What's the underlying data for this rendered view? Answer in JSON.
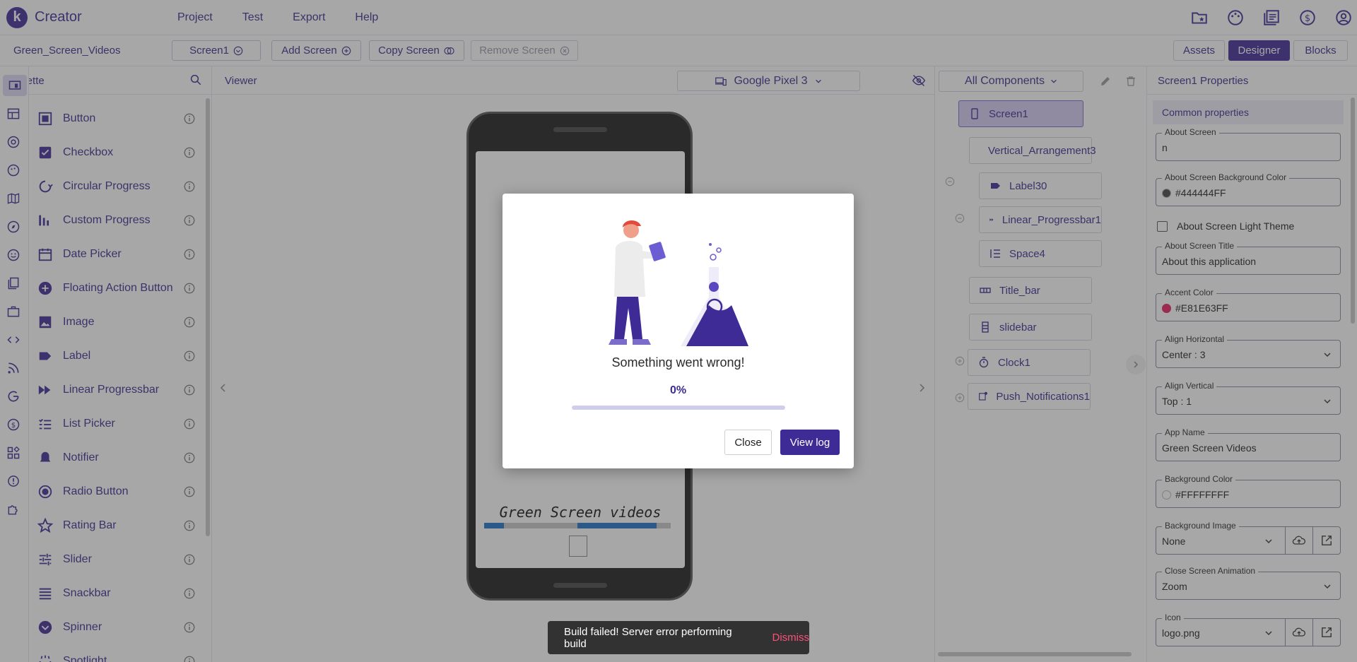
{
  "app": {
    "name": "Creator",
    "logo_letter": "k"
  },
  "menu": [
    "Project",
    "Test",
    "Export",
    "Help"
  ],
  "top_icons": [
    "folder-star-icon",
    "palette-icon",
    "library-icon",
    "dollar-icon",
    "account-icon"
  ],
  "project": {
    "name": "Green_Screen_Videos"
  },
  "screen_buttons": {
    "screen": "Screen1",
    "add": "Add Screen",
    "copy": "Copy Screen",
    "remove": "Remove Screen"
  },
  "mode_tabs": {
    "assets": "Assets",
    "designer": "Designer",
    "blocks": "Blocks"
  },
  "palette": {
    "title": "Palette",
    "items": [
      "Button",
      "Checkbox",
      "Circular Progress",
      "Custom Progress",
      "Date Picker",
      "Floating Action Button",
      "Image",
      "Label",
      "Linear Progressbar",
      "List Picker",
      "Notifier",
      "Radio Button",
      "Rating Bar",
      "Slider",
      "Snackbar",
      "Spinner",
      "Spotlight"
    ]
  },
  "viewer": {
    "title": "Viewer",
    "device": "Google Pixel 3",
    "screen_text": "Green Screen videos"
  },
  "tree": {
    "filter": "All Components",
    "nodes": [
      "Screen1",
      "Vertical_Arrangement3",
      "Label30",
      "Linear_Progressbar1",
      "Space4",
      "Title_bar",
      "slidebar",
      "Clock1",
      "Push_Notifications1"
    ]
  },
  "props": {
    "title": "Screen1 Properties",
    "section": "Common properties",
    "about_screen": {
      "label": "About Screen",
      "value": "n"
    },
    "about_bg": {
      "label": "About Screen Background Color",
      "value": "#444444FF",
      "swatch": "#444444"
    },
    "light_theme": "About Screen Light Theme",
    "about_title": {
      "label": "About Screen Title",
      "value": "About this application"
    },
    "accent": {
      "label": "Accent Color",
      "value": "#E81E63FF",
      "swatch": "#E81E63"
    },
    "align_h": {
      "label": "Align Horizontal",
      "value": "Center : 3"
    },
    "align_v": {
      "label": "Align Vertical",
      "value": "Top : 1"
    },
    "app_name": {
      "label": "App Name",
      "value": "Green Screen Videos"
    },
    "bg_color": {
      "label": "Background Color",
      "value": "#FFFFFFFF",
      "swatch": "#FFFFFF"
    },
    "bg_image": {
      "label": "Background Image",
      "value": "None"
    },
    "close_anim": {
      "label": "Close Screen Animation",
      "value": "Zoom"
    },
    "icon": {
      "label": "Icon",
      "value": "logo.png"
    }
  },
  "dialog": {
    "message": "Something went wrong!",
    "progress": "0%",
    "close": "Close",
    "view_log": "View log"
  },
  "snackbar": {
    "message": "Build failed! Server error performing build",
    "action": "Dismiss"
  },
  "colors": {
    "primary": "#3F2B96",
    "danger": "#FF4F7B"
  }
}
